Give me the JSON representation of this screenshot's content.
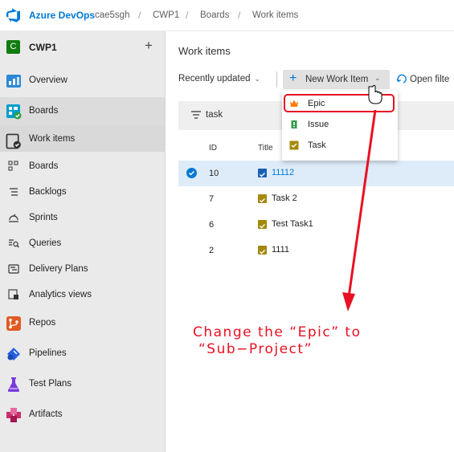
{
  "topbar": {
    "brand": "Azure DevOps",
    "breadcrumbs": [
      "cae5sgh",
      "CWP1",
      "Boards",
      "Work items"
    ],
    "separator": "/"
  },
  "sidebar": {
    "project_initial": "C",
    "project_name": "CWP1",
    "add_symbol": "+",
    "items": [
      {
        "label": "Overview",
        "icon": "overview-icon"
      },
      {
        "label": "Boards",
        "icon": "boards-hub-icon"
      },
      {
        "label": "Work items",
        "icon": "work-items-icon",
        "selected": true
      },
      {
        "label": "Boards",
        "icon": "boards-icon"
      },
      {
        "label": "Backlogs",
        "icon": "backlogs-icon"
      },
      {
        "label": "Sprints",
        "icon": "sprints-icon"
      },
      {
        "label": "Queries",
        "icon": "queries-icon"
      },
      {
        "label": "Delivery Plans",
        "icon": "delivery-plans-icon"
      },
      {
        "label": "Analytics views",
        "icon": "analytics-icon"
      },
      {
        "label": "Repos",
        "icon": "repos-icon"
      },
      {
        "label": "Pipelines",
        "icon": "pipelines-icon"
      },
      {
        "label": "Test Plans",
        "icon": "test-plans-icon"
      },
      {
        "label": "Artifacts",
        "icon": "artifacts-icon"
      }
    ]
  },
  "main": {
    "title": "Work items",
    "toolbar": {
      "view_label": "Recently updated",
      "new_item_label": "New Work Item",
      "open_filter_label": "Open filte"
    },
    "filter_text": "task",
    "columns": {
      "id": "ID",
      "title": "Title"
    },
    "rows": [
      {
        "id": "10",
        "title": "11112",
        "type": "Epic",
        "selected": true
      },
      {
        "id": "7",
        "title": "Task 2",
        "type": "Task"
      },
      {
        "id": "6",
        "title": "Test Task1",
        "type": "Task"
      },
      {
        "id": "2",
        "title": "1111",
        "type": "Task"
      }
    ]
  },
  "dropdown": {
    "items": [
      {
        "label": "Epic",
        "icon": "epic-crown-icon"
      },
      {
        "label": "Issue",
        "icon": "issue-icon"
      },
      {
        "label": "Task",
        "icon": "task-icon"
      }
    ]
  },
  "annotation": {
    "line1": "Change the “Epic” to",
    "line2": "“Sub−Project”"
  },
  "colors": {
    "accent": "#0078d4",
    "annotation_red": "#e81123",
    "epic": "#ff7b00",
    "issue": "#339947",
    "task": "#a4880a",
    "project_avatar": "#107c10"
  }
}
